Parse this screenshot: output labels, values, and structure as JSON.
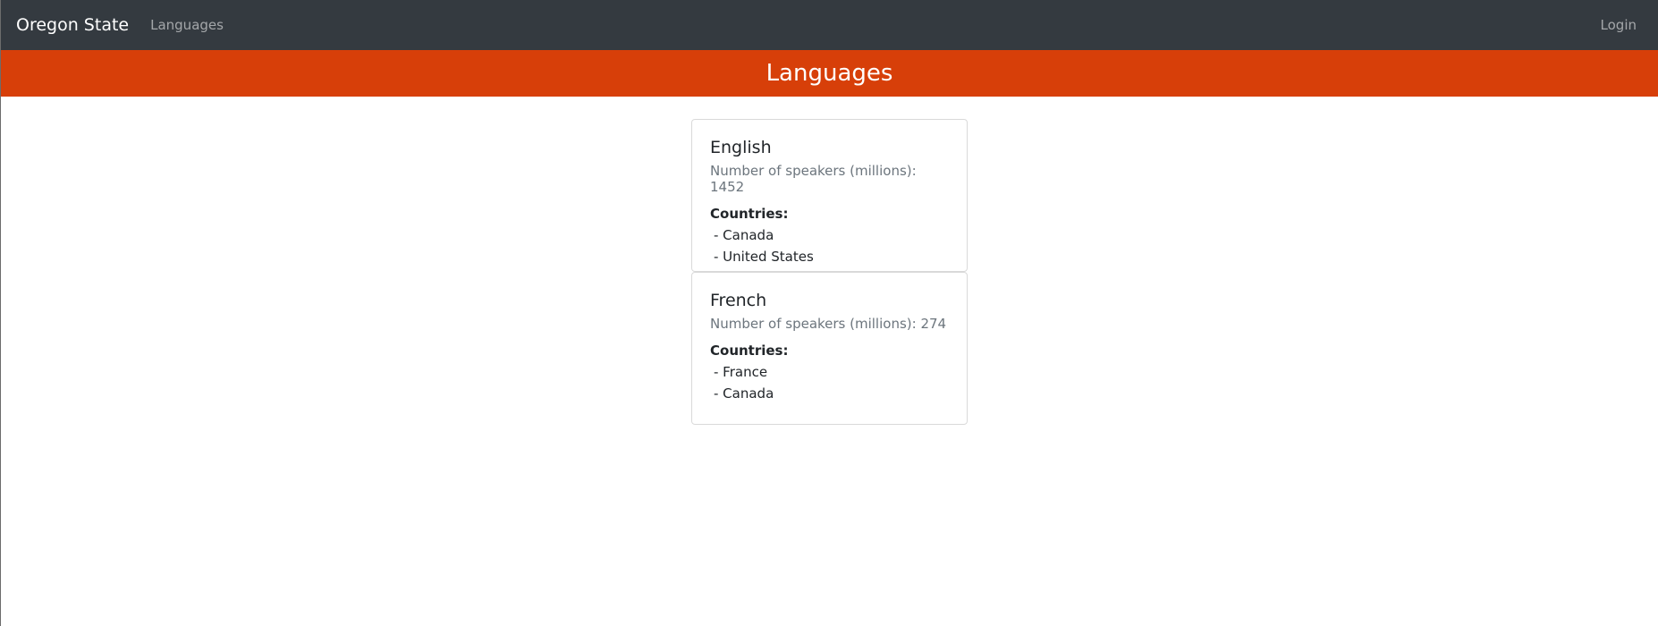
{
  "navbar": {
    "brand": "Oregon State",
    "links": [
      "Languages"
    ],
    "login": "Login"
  },
  "banner": {
    "title": "Languages"
  },
  "languages": [
    {
      "name": "English",
      "speakers_label": "Number of speakers (millions): 1452",
      "countries_label": "Countries:",
      "countries": [
        " - Canada",
        " - United States"
      ]
    },
    {
      "name": "French",
      "speakers_label": "Number of speakers (millions): 274",
      "countries_label": "Countries:",
      "countries": [
        " - France",
        " - Canada"
      ]
    }
  ],
  "colors": {
    "navbar_bg": "#343a40",
    "banner_bg": "#d73f09"
  }
}
